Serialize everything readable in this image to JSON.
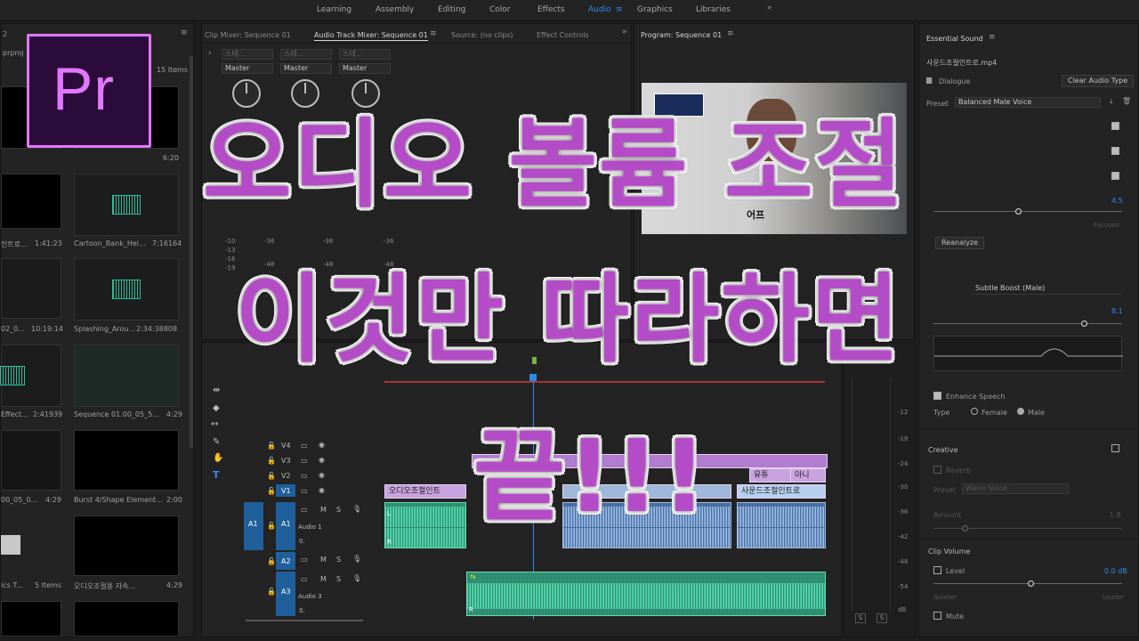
{
  "workspaces": [
    "Learning",
    "Assembly",
    "Editing",
    "Color",
    "Effects",
    "Audio",
    "Graphics",
    "Libraries"
  ],
  "workspace_active": "Audio",
  "project": {
    "name_fragment": "prproj",
    "panel_num": "2",
    "count": "15 Items",
    "items": [
      {
        "name": "",
        "dur": "6:20"
      },
      {
        "name": "인트로...",
        "dur": "1:41:23"
      },
      {
        "name": "Cartoon_Bank_Hei...",
        "dur": "7:16164"
      },
      {
        "name": "02_0...",
        "dur": "10:19:14"
      },
      {
        "name": "Splashing_Arou...",
        "dur": "2:34:38808"
      },
      {
        "name": "Effect...",
        "dur": "2:41939"
      },
      {
        "name": "Sequence 01.00_05_5...",
        "dur": "4:29"
      },
      {
        "name": "00_05_0...",
        "dur": "4:29"
      },
      {
        "name": "Burst 4/Shape Element...",
        "dur": "2:00"
      },
      {
        "name": "ics T...",
        "dur": "5 Items"
      },
      {
        "name": "오디오조절용 자속...",
        "dur": "4:29"
      }
    ]
  },
  "mixer": {
    "tabs": [
      "Clip Mixer: Sequence 01",
      "Audio Track Mixer: Sequence 01",
      "Source: (no clips)",
      "Effect Controls"
    ],
    "channels": [
      {
        "top": "스테...",
        "bus": "Master"
      },
      {
        "top": "스테...",
        "bus": "Master"
      },
      {
        "top": "스테...",
        "bus": "Master"
      }
    ],
    "scale": [
      "-10",
      "-13",
      "-16",
      "-19",
      "-25",
      "-36",
      "-48"
    ],
    "track_name": "A3"
  },
  "program": {
    "title": "Program: Sequence 01",
    "caption_fragment": "어프",
    "meter_scale": [
      "-12",
      "-18",
      "-24",
      "-30",
      "-36",
      "-42",
      "-48",
      "-54",
      "dB"
    ],
    "solo": [
      "S",
      "S"
    ]
  },
  "timeline": {
    "tracks": [
      {
        "id": "V4"
      },
      {
        "id": "V3"
      },
      {
        "id": "V2"
      },
      {
        "id": "V1"
      },
      {
        "id": "A1",
        "name": "Audio 1"
      },
      {
        "id": "A2"
      },
      {
        "id": "A3",
        "name": "Audio 3"
      }
    ],
    "source_patch": "A1",
    "ctrl_m": "M",
    "ctrl_s": "S",
    "vol_value": "0.",
    "clips_v": [
      "오디오조절인트",
      "유튜",
      "아니",
      "사운드조절인트로"
    ],
    "clip_fx": "fx",
    "clip_label_L": "L",
    "clip_label_R": "R"
  },
  "essential_sound": {
    "title": "Essential Sound",
    "file": "사운드조절인트로.mp4",
    "dialogue": "Dialogue",
    "clear_btn": "Clear Audio Type",
    "preset_label": "Preset",
    "preset_value": "Balanced Male Voice",
    "val_45": "4.5",
    "focused": "Focused",
    "reanalyze": "Reanalyze",
    "eq_preset": "Subtle Boost (Male)",
    "val_81": "8.1",
    "enhance": "Enhance Speech",
    "type_label": "Type",
    "female": "Female",
    "male": "Male",
    "creative": "Creative",
    "reverb": "Reverb",
    "reverb_preset_label": "Preset",
    "reverb_preset": "Warm Voice",
    "amount": "Amount",
    "amount_val": "1.8",
    "clip_volume": "Clip Volume",
    "level": "Level",
    "level_val": "0.0 dB",
    "quieter": "Quieter",
    "louder": "Louder",
    "mute": "Mute"
  },
  "logo": "Pr",
  "overlay": {
    "line1": "오디오 볼륨 조절",
    "line2": "이것만 따라하면",
    "line3": "끝!!!"
  },
  "colors": {
    "accent_blue": "#2d8ceb",
    "overlay_purple": "#b44bc7",
    "logo_pink": "#e277ff",
    "video_clip": "#c9a3e0",
    "audio_clip_green": "#2f8f72",
    "audio_clip_blue": "#4a6f9e"
  }
}
